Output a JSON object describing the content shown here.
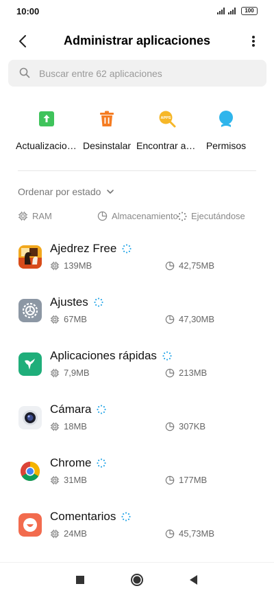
{
  "status": {
    "time": "10:00",
    "battery": "100"
  },
  "header": {
    "title": "Administrar aplicaciones"
  },
  "search": {
    "placeholder": "Buscar entre 62 aplicaciones"
  },
  "actions": [
    {
      "label": "Actualizaciones",
      "icon": "update-icon",
      "color": "#3fc35b"
    },
    {
      "label": "Desinstalar",
      "icon": "trash-icon",
      "color": "#f57c22"
    },
    {
      "label": "Encontrar aplicaciones",
      "icon": "apps-search-icon",
      "color": "#f6b728"
    },
    {
      "label": "Permisos",
      "icon": "permissions-icon",
      "color": "#2fb5ec"
    }
  ],
  "sort": {
    "label": "Ordenar por estado"
  },
  "columns": {
    "ram": "RAM",
    "storage": "Almacenamiento",
    "running": "Ejecutándose"
  },
  "apps": [
    {
      "name": "Ajedrez Free",
      "ram": "139MB",
      "storage": "42,75MB",
      "icon": "chess-icon"
    },
    {
      "name": "Ajustes",
      "ram": "67MB",
      "storage": "47,30MB",
      "icon": "settings-app-icon"
    },
    {
      "name": "Aplicaciones rápidas",
      "ram": "7,9MB",
      "storage": "213MB",
      "icon": "quick-apps-icon"
    },
    {
      "name": "Cámara",
      "ram": "18MB",
      "storage": "307KB",
      "icon": "camera-icon"
    },
    {
      "name": "Chrome",
      "ram": "31MB",
      "storage": "177MB",
      "icon": "chrome-icon"
    },
    {
      "name": "Comentarios",
      "ram": "24MB",
      "storage": "45,73MB",
      "icon": "feedback-icon"
    }
  ],
  "colors": {
    "accent": "#2fa9e8",
    "text": "#111111",
    "muted": "#888888"
  }
}
